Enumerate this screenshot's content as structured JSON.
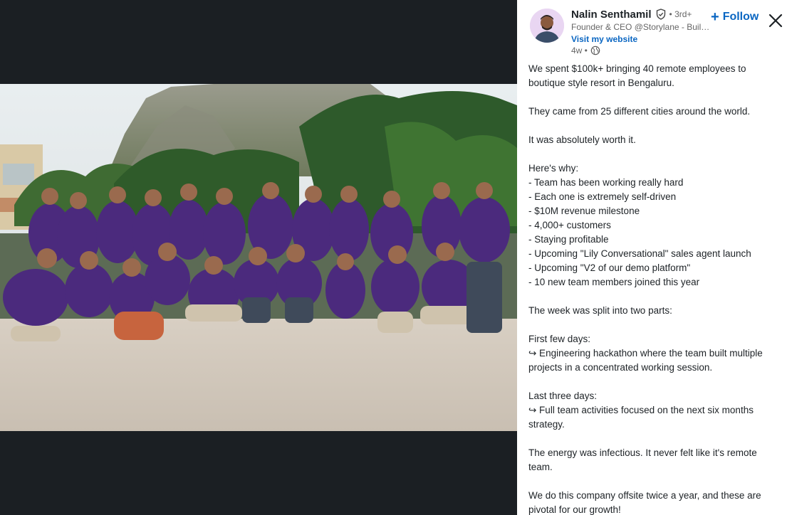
{
  "author": {
    "name": "Nalin Senthamil",
    "degree": "• 3rd+",
    "headline": "Founder & CEO @Storylane - Buil…",
    "website_label": "Visit my website",
    "time": "4w •"
  },
  "actions": {
    "follow_label": "Follow",
    "follow_icon": "plus-icon",
    "close_icon": "close-icon"
  },
  "post_lines": [
    "We spent $100k+ bringing 40 remote employees to",
    "boutique style resort in Bengaluru.",
    "",
    "They came from 25 different cities around the world.",
    "",
    "It was absolutely worth it.",
    "",
    "Here's why:",
    "- Team has been working really hard",
    "- Each one is extremely self-driven",
    "- $10M revenue milestone",
    "- 4,000+ customers",
    "- Staying profitable",
    "- Upcoming \"Lily Conversational\" sales agent launch",
    "- Upcoming \"V2 of our demo platform\"",
    "- 10 new team members joined this year",
    "",
    "The week was split into two parts:",
    "",
    "First few days:",
    "↪ Engineering hackathon where the team built multiple",
    "projects in a concentrated working session.",
    "",
    "Last three days:",
    "↪ Full team activities focused on the next six months",
    "strategy.",
    "",
    "The energy was infectious. It never felt like it's remote",
    "team.",
    "",
    "We do this company offsite twice a year, and these are",
    "pivotal for our growth!"
  ],
  "colors": {
    "link": "#0a66c2",
    "text": "#1d2226",
    "muted": "#666666",
    "hoodie": "#4b2a7d",
    "background": "#1b1f23"
  }
}
